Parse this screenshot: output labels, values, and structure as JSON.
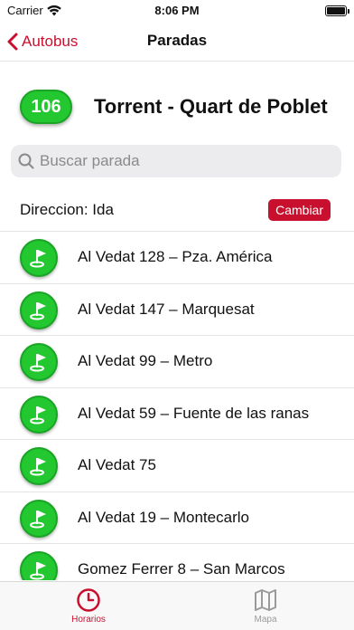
{
  "status_bar": {
    "carrier": "Carrier",
    "time": "8:06 PM"
  },
  "nav": {
    "back_label": "Autobus",
    "title": "Paradas"
  },
  "route": {
    "number": "106",
    "name": "Torrent - Quart de Poblet",
    "badge_color": "#23c72f"
  },
  "search": {
    "placeholder": "Buscar parada",
    "value": ""
  },
  "direction": {
    "label": "Direccion: Ida",
    "change_label": "Cambiar"
  },
  "stops": [
    {
      "name": "Al Vedat 128 – Pza. América",
      "icon": "golf-flag-icon"
    },
    {
      "name": "Al Vedat 147 – Marquesat",
      "icon": "golf-flag-icon"
    },
    {
      "name": "Al Vedat 99 – Metro",
      "icon": "golf-flag-icon"
    },
    {
      "name": "Al Vedat 59 – Fuente de las ranas",
      "icon": "golf-flag-icon"
    },
    {
      "name": "Al Vedat 75",
      "icon": "golf-flag-icon"
    },
    {
      "name": "Al Vedat 19 – Montecarlo",
      "icon": "golf-flag-icon"
    },
    {
      "name": "Gomez Ferrer 8 – San Marcos",
      "icon": "golf-flag-icon"
    }
  ],
  "tabs": [
    {
      "label": "Horarios",
      "icon": "clock-icon",
      "active": true
    },
    {
      "label": "Mapa",
      "icon": "map-icon",
      "active": false
    }
  ],
  "colors": {
    "accent": "#c8102e",
    "stop_green": "#23c72f"
  }
}
